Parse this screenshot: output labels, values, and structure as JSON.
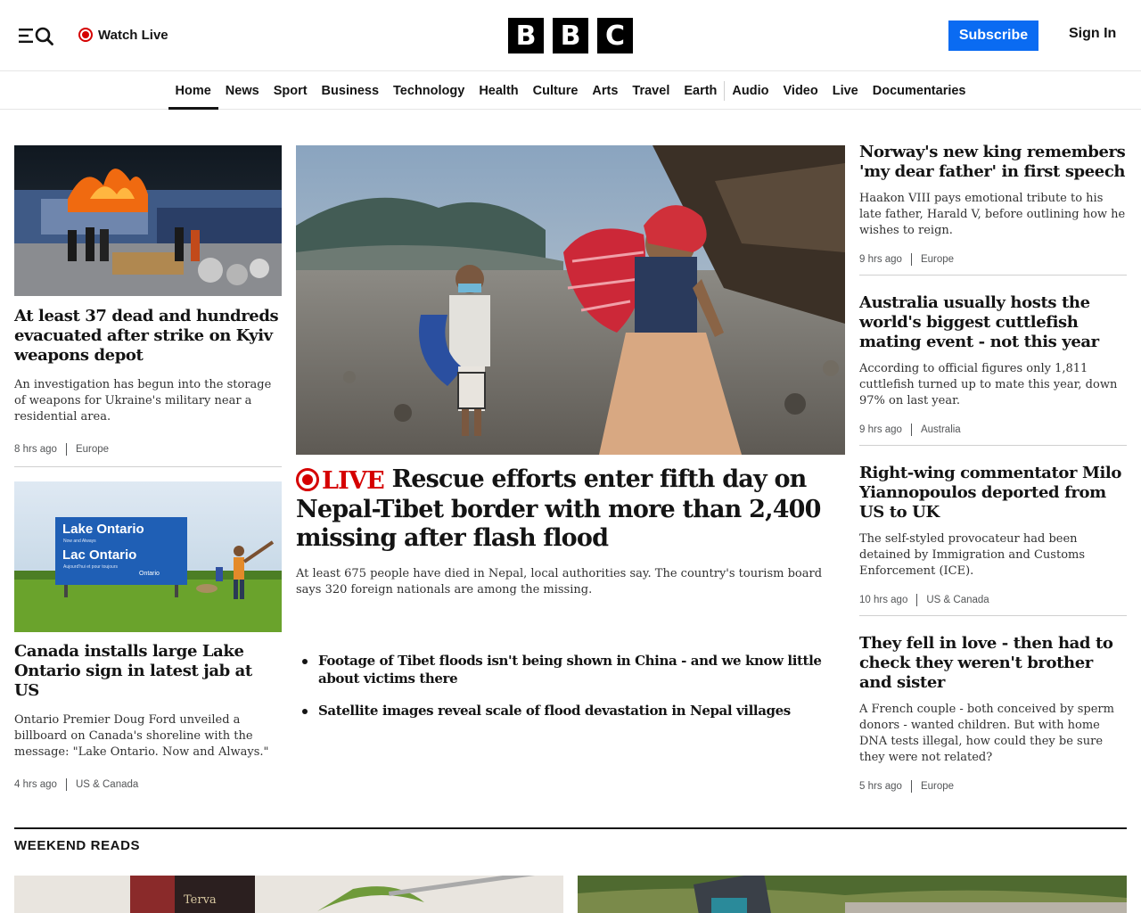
{
  "header": {
    "watch_live": "Watch Live",
    "logo_letters": [
      "B",
      "B",
      "C"
    ],
    "subscribe": "Subscribe",
    "sign_in": "Sign In"
  },
  "nav": {
    "items": [
      "Home",
      "News",
      "Sport",
      "Business",
      "Technology",
      "Health",
      "Culture",
      "Arts",
      "Travel",
      "Earth",
      "Audio",
      "Video",
      "Live",
      "Documentaries"
    ],
    "active": "Home"
  },
  "left": {
    "story1": {
      "headline": "At least 37 dead and hundreds evacuated after strike on Kyiv weapons depot",
      "summary": "An investigation has begun into the storage of weapons for Ukraine's military near a residential area.",
      "time": "8 hrs ago",
      "section": "Europe"
    },
    "story2": {
      "image_text_1": "Lake Ontario",
      "image_text_2": "Now and Always",
      "image_text_3": "Lac Ontario",
      "image_text_4": "Aujourd'hui et pour toujours",
      "image_text_5": "Ontario",
      "headline": "Canada installs large Lake Ontario sign in latest jab at US",
      "summary": "Ontario Premier Doug Ford unveiled a billboard on Canada's shoreline with the message: \"Lake Ontario. Now and Always.\"",
      "time": "4 hrs ago",
      "section": "US & Canada"
    }
  },
  "main": {
    "live_label": "LIVE",
    "headline": "Rescue efforts enter fifth day on Nepal-Tibet border with more than 2,400 missing after flash flood",
    "summary": "At least 675 people have died in Nepal, local authorities say. The country's tourism board says 320 foreign nationals are among the missing.",
    "bullets": [
      "Footage of Tibet floods isn't being shown in China - and we know little about victims there",
      "Satellite images reveal scale of flood devastation in Nepal villages"
    ]
  },
  "right": {
    "stories": [
      {
        "headline": "Norway's new king remembers 'my dear father' in first speech",
        "summary": "Haakon VIII pays emotional tribute to his late father, Harald V, before outlining how he wishes to reign.",
        "time": "9 hrs ago",
        "section": "Europe"
      },
      {
        "headline": "Australia usually hosts the world's biggest cuttlefish mating event - not this year",
        "summary": "According to official figures only 1,811 cuttlefish turned up to mate this year, down 97% on last year.",
        "time": "9 hrs ago",
        "section": "Australia"
      },
      {
        "headline": "Right-wing commentator Milo Yiannopoulos deported from US to UK",
        "summary": "The self-styled provocateur had been detained by Immigration and Customs Enforcement (ICE).",
        "time": "10 hrs ago",
        "section": "US & Canada"
      },
      {
        "headline": "They fell in love - then had to check they weren't brother and sister",
        "summary": "A French couple - both conceived by sperm donors - wanted children. But with home DNA tests illegal, how could they be sure they were not related?",
        "time": "5 hrs ago",
        "section": "Europe"
      }
    ]
  },
  "weekend": {
    "title": "WEEKEND READS",
    "image_text": "Terva"
  },
  "colors": {
    "brand_black": "#000000",
    "subscribe_blue": "#0a6bf2",
    "live_red": "#d50000"
  }
}
